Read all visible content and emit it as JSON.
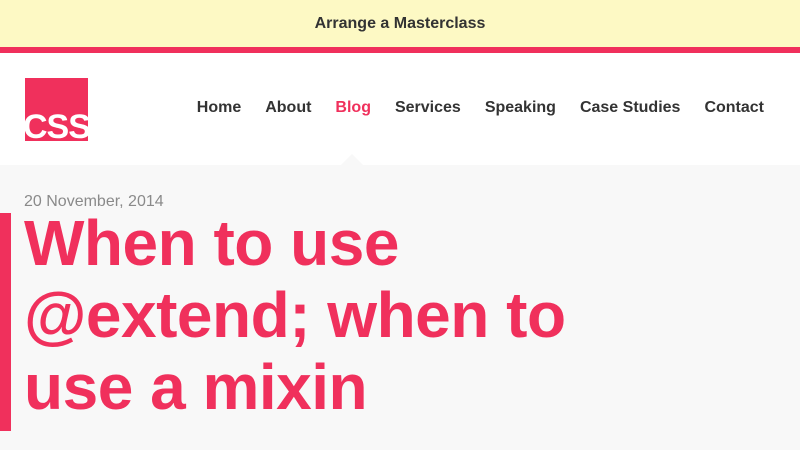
{
  "promo": {
    "text": "Arrange a Masterclass"
  },
  "logo": {
    "text": "CSS"
  },
  "nav": {
    "items": [
      {
        "label": "Home"
      },
      {
        "label": "About"
      },
      {
        "label": "Blog"
      },
      {
        "label": "Services"
      },
      {
        "label": "Speaking"
      },
      {
        "label": "Case Studies"
      },
      {
        "label": "Contact"
      }
    ],
    "active": "Blog"
  },
  "post": {
    "date": "20 November, 2014",
    "title": "When to use @extend; when to use a mixin"
  },
  "colors": {
    "accent": "#f0305c",
    "promo_background": "#fdf9c4",
    "header_background": "#ffffff",
    "page_background": "#f8f8f8",
    "nav_text": "#333333",
    "date_text": "#8a8a8a"
  }
}
